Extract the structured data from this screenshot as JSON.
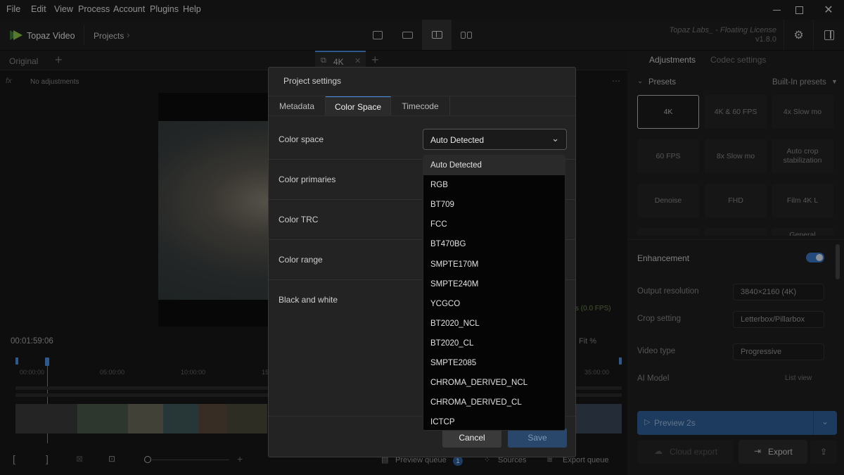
{
  "menubar": {
    "items": [
      "File",
      "Edit",
      "View",
      "Process",
      "Account",
      "Plugins",
      "Help"
    ]
  },
  "toolbar": {
    "app_name": "Topaz Video",
    "breadcrumb": "Projects",
    "license_text": "Topaz Labs_ - Floating License",
    "version": "v1.8.0"
  },
  "viewer": {
    "original_tab": "Original",
    "output_tab": "4K",
    "fx_label": "fx",
    "no_adjustments": "No adjustments",
    "fps_text": "s (0.0 FPS)",
    "timecode": "00:01:59:06",
    "fit_label": "Fit %",
    "ruler_ticks": [
      "00:00:00",
      "05:00:00",
      "10:00:00",
      "15",
      "35:00:00"
    ]
  },
  "bottombar": {
    "preview_queue": "Preview queue",
    "preview_queue_count": "1",
    "sources": "Sources",
    "export_queue": "Export queue"
  },
  "rightpanel": {
    "tabs": [
      "Adjustments",
      "Codec settings"
    ],
    "presets_label": "Presets",
    "presets_source": "Built-In presets",
    "presets": [
      "4K",
      "4K & 60 FPS",
      "4x Slow mo",
      "60 FPS",
      "8x Slow mo",
      "Auto crop stabilization",
      "Denoise",
      "FHD",
      "Film 4K L",
      "",
      "",
      "General"
    ],
    "enhancement_label": "Enhancement",
    "enhancement_on": true,
    "output_resolution_label": "Output resolution",
    "output_resolution_value": "3840×2160 (4K)",
    "crop_setting_label": "Crop setting",
    "crop_setting_value": "Letterbox/Pillarbox",
    "video_type_label": "Video type",
    "video_type_value": "Progressive",
    "ai_model_label": "AI Model",
    "list_view_label": "List view",
    "preview_button": "Preview 2s",
    "cloud_export_button": "Cloud export",
    "export_button": "Export"
  },
  "modal": {
    "title": "Project settings",
    "tabs": [
      "Metadata",
      "Color Space",
      "Timecode"
    ],
    "active_tab": "Color Space",
    "rows": [
      "Color space",
      "Color primaries",
      "Color TRC",
      "Color range",
      "Black and white"
    ],
    "color_space_value": "Auto Detected",
    "dropdown_options": [
      "Auto Detected",
      "RGB",
      "BT709",
      "FCC",
      "BT470BG",
      "SMPTE170M",
      "SMPTE240M",
      "YCGCO",
      "BT2020_NCL",
      "BT2020_CL",
      "SMPTE2085",
      "CHROMA_DERIVED_NCL",
      "CHROMA_DERIVED_CL",
      "ICTCP"
    ],
    "cancel_label": "Cancel",
    "save_label": "Save"
  },
  "colors": {
    "accent": "#4a90e2",
    "brand_green": "#8bc34a",
    "save_bg": "#28476b"
  }
}
